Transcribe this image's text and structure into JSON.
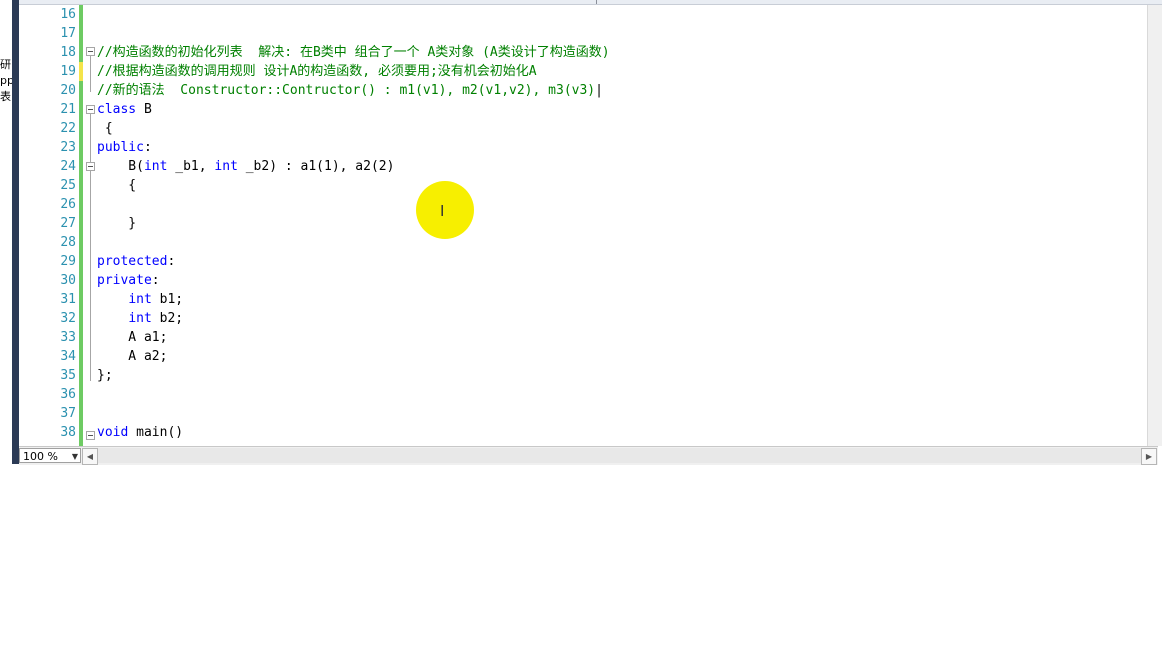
{
  "left_panel": {
    "text_fragments": [
      "研",
      "pp",
      "表"
    ]
  },
  "editor": {
    "line_numbers": [
      "16",
      "17",
      "18",
      "19",
      "20",
      "21",
      "22",
      "23",
      "24",
      "25",
      "26",
      "27",
      "28",
      "29",
      "30",
      "31",
      "32",
      "33",
      "34",
      "35",
      "36",
      "37",
      "38"
    ],
    "lines": {
      "l18": "//构造函数的初始化列表  解决: 在B类中 组合了一个 A类对象 (A类设计了构造函数)",
      "l19": "//根据构造函数的调用规则 设计A的构造函数, 必须要用;没有机会初始化A",
      "l20": "//新的语法  Constructor::Contructor() : m1(v1), m2(v1,v2), m3(v3)",
      "l21_kw": "class",
      "l21_rest": " B",
      "l22": " {",
      "l23_kw": "public",
      "l23_rest": ":",
      "l24": "    B(int _b1, int _b2) : a1(1), a2(2)",
      "l24_pre": "    B(",
      "l24_int1": "int",
      "l24_mid": " _b1, ",
      "l24_int2": "int",
      "l24_post": " _b2) : a1(1), a2(2)",
      "l25": "    {",
      "l27": "    }",
      "l29_kw": "protected",
      "l29_rest": ":",
      "l30_kw": "private",
      "l30_rest": ":",
      "l31_kw": "int",
      "l31_rest": " b1;",
      "l32_kw": "int",
      "l32_rest": " b2;",
      "l33": "    A a1;",
      "l34": "    A a2;",
      "l35": "};",
      "l38_kw": "void",
      "l38_rest": " main()"
    }
  },
  "statusbar": {
    "zoom": "100 %",
    "zoom_arrow": "▼",
    "scroll_left": "◀",
    "scroll_right": "▶"
  },
  "colors": {
    "line_number": "#2b91af",
    "keyword": "#0000ff",
    "comment": "#008000",
    "change_bar": "#6ecb63",
    "cursor_highlight": "#f7ef00"
  },
  "icons": {
    "ibeam": "text-cursor-icon",
    "ibeam_glyph": "I"
  }
}
